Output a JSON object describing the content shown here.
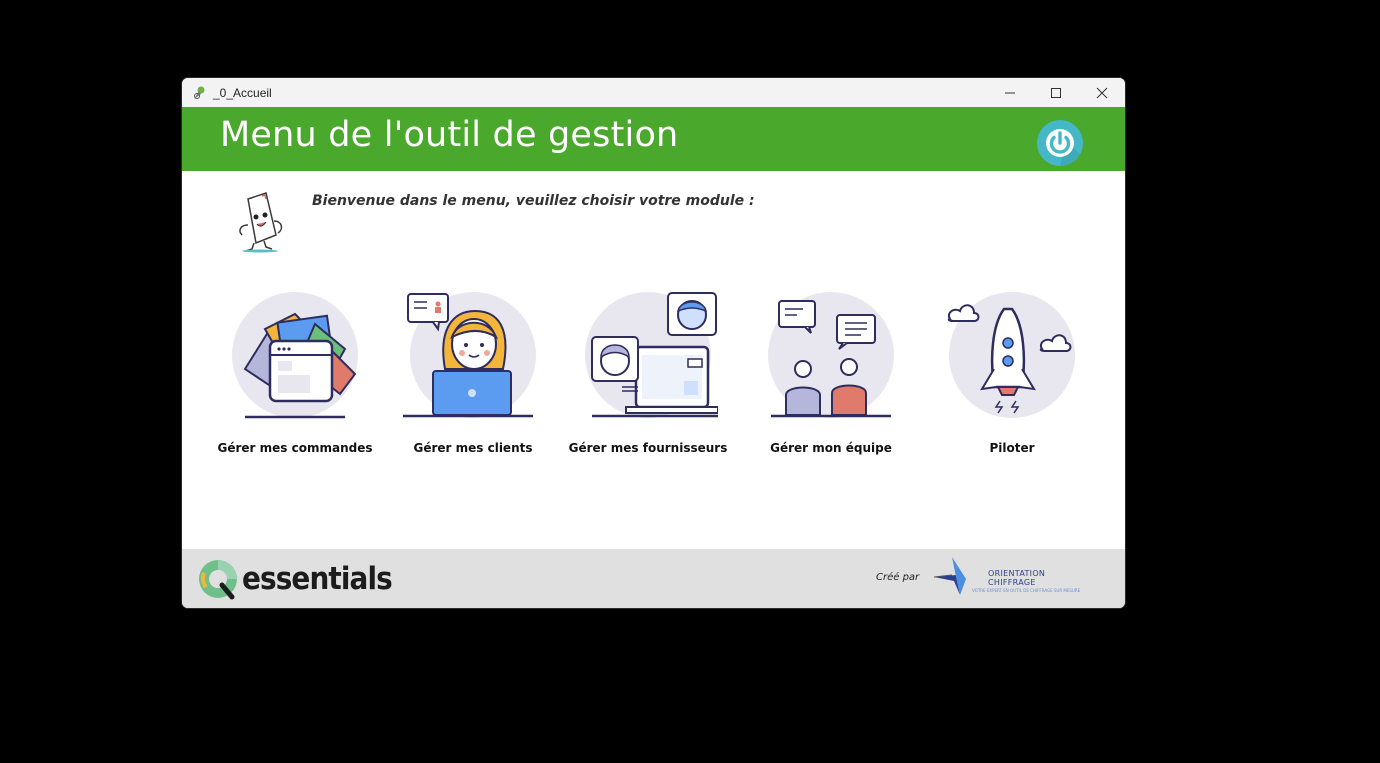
{
  "window": {
    "title": "_0_Accueil"
  },
  "header": {
    "title": "Menu de l'outil de gestion"
  },
  "welcome": {
    "text": "Bienvenue dans le menu, veuillez choisir votre module :"
  },
  "modules": [
    {
      "label": "Gérer mes commandes",
      "icon": "folders-icon"
    },
    {
      "label": "Gérer mes clients",
      "icon": "support-agent-icon"
    },
    {
      "label": "Gérer mes fournisseurs",
      "icon": "video-call-icon"
    },
    {
      "label": "Gérer mon équipe",
      "icon": "team-chat-icon"
    },
    {
      "label": "Piloter",
      "icon": "rocket-icon"
    }
  ],
  "footer": {
    "brand": "essentials",
    "created_by": "Créé par",
    "partner_line1": "ORIENTATION",
    "partner_line2": "CHIFFRAGE",
    "partner_tagline": "VOTRE EXPERT EN OUTIL DE CHIFFRAGE SUR MESURE"
  },
  "colors": {
    "header": "#4aa82d",
    "power": "#46b7c6",
    "footer": "#e0e0e0",
    "outline": "#2f2c5e",
    "circle": "#e8e7ef"
  }
}
